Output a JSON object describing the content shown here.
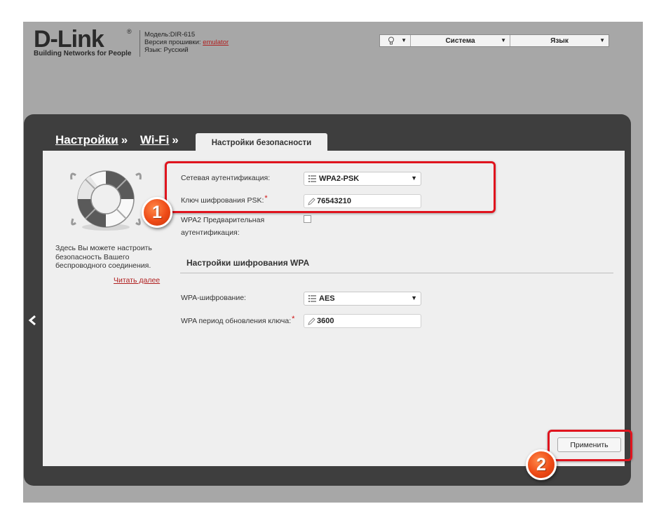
{
  "brand": {
    "logo": "D-Link",
    "reg": "®",
    "tagline": "Building Networks for People"
  },
  "device_info": {
    "model": "Модель:DIR-615",
    "firmware_label": "Версия прошивки:",
    "firmware_value": "emulator",
    "language": "Язык: Русский"
  },
  "topbar": {
    "bulb_icon": "lightbulb-icon",
    "system_label": "Система",
    "language_label": "Язык"
  },
  "breadcrumb": {
    "item1": "Настройки",
    "item2": "Wi-Fi",
    "separator": "»",
    "active_tab": "Настройки безопасности"
  },
  "sidebar": {
    "description": "Здесь Вы можете настроить безопасность Вашего беспроводного соединения.",
    "read_more": "Читать далее"
  },
  "form": {
    "auth_label": "Сетевая аутентификация:",
    "auth_value": "WPA2-PSK",
    "psk_label": "Ключ шифрования PSK:",
    "psk_value": "76543210",
    "preauth_label_1": "WPA2 Предварительная",
    "preauth_label_2": "аутентификация:",
    "required_mark": "*",
    "wpa_section_title": "Настройки шифрования WPA",
    "wpa_cipher_label": "WPA-шифрование:",
    "wpa_cipher_value": "AES",
    "rekey_label": "WPA период обновления ключа:",
    "rekey_value": "3600"
  },
  "apply_label": "Применить",
  "annotations": {
    "badge1": "1",
    "badge2": "2",
    "highlight_color": "#e0141e"
  },
  "colors": {
    "accent_red": "#b02020",
    "panel_dark": "#3e3e3e",
    "outer_gray": "#a7a7a7"
  }
}
